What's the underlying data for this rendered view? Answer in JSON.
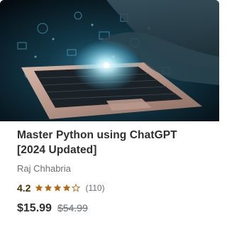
{
  "course": {
    "title_line1": "Master Python using ChatGPT",
    "title_line2": "[2024 Updated]",
    "author": "Raj Chhabria",
    "rating": "4.2",
    "rating_stars": 4.2,
    "rating_count": "(110)",
    "price": "$15.99",
    "original_price": "$54.99"
  },
  "thumbnail": {
    "icon": "laptop-hands-image",
    "colors": {
      "bg_dark": "#0a1a22",
      "glow": "#7fe3ff",
      "laptop": "#c9a99a"
    }
  },
  "colors": {
    "star": "#b4690e",
    "rating": "#4d3105",
    "text": "#2d2f31",
    "muted": "#6a6f73"
  }
}
